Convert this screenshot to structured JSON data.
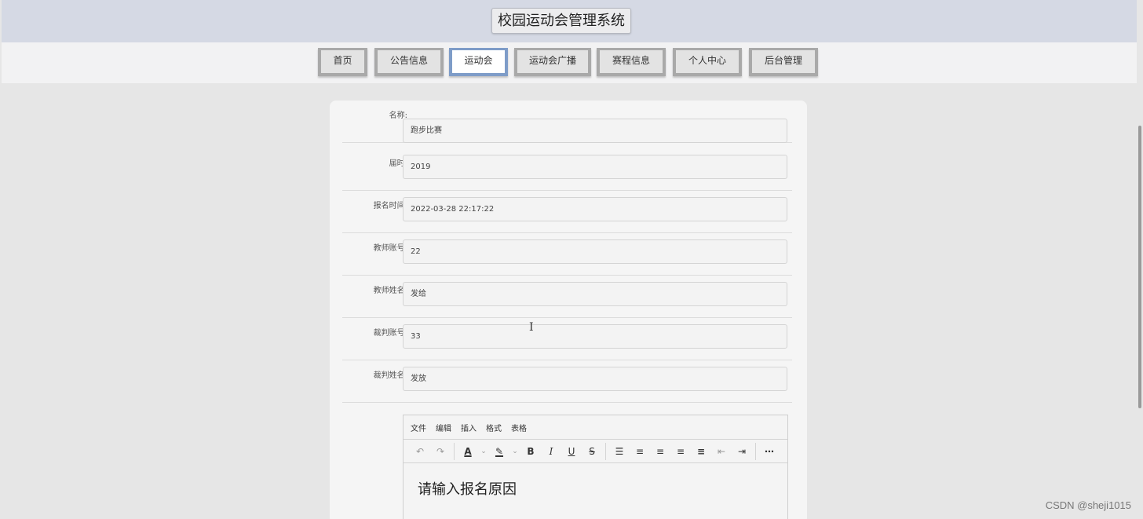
{
  "site": {
    "title": "校园运动会管理系统"
  },
  "nav": {
    "items": [
      {
        "label": "首页"
      },
      {
        "label": "公告信息"
      },
      {
        "label": "运动会"
      },
      {
        "label": "运动会广播"
      },
      {
        "label": "赛程信息"
      },
      {
        "label": "个人中心"
      },
      {
        "label": "后台管理"
      }
    ],
    "active": "运动会"
  },
  "form": {
    "fields": [
      {
        "label": "名称:",
        "value": "跑步比赛"
      },
      {
        "label": "届时:",
        "value": "2019"
      },
      {
        "label": "报名时间:",
        "value": "2022-03-28 22:17:22"
      },
      {
        "label": "教师账号:",
        "value": "22"
      },
      {
        "label": "教师姓名:",
        "value": "发给"
      },
      {
        "label": "裁判账号:",
        "value": "33"
      },
      {
        "label": "裁判姓名:",
        "value": "发放"
      }
    ]
  },
  "editor": {
    "menu": [
      "文件",
      "编辑",
      "插入",
      "格式",
      "表格"
    ],
    "placeholder": "请输入报名原因"
  },
  "watermark": "CSDN @sheji1015",
  "colors": {
    "header_bg": "#d5d9e4",
    "active_tab_border": "#7e9cc8"
  }
}
